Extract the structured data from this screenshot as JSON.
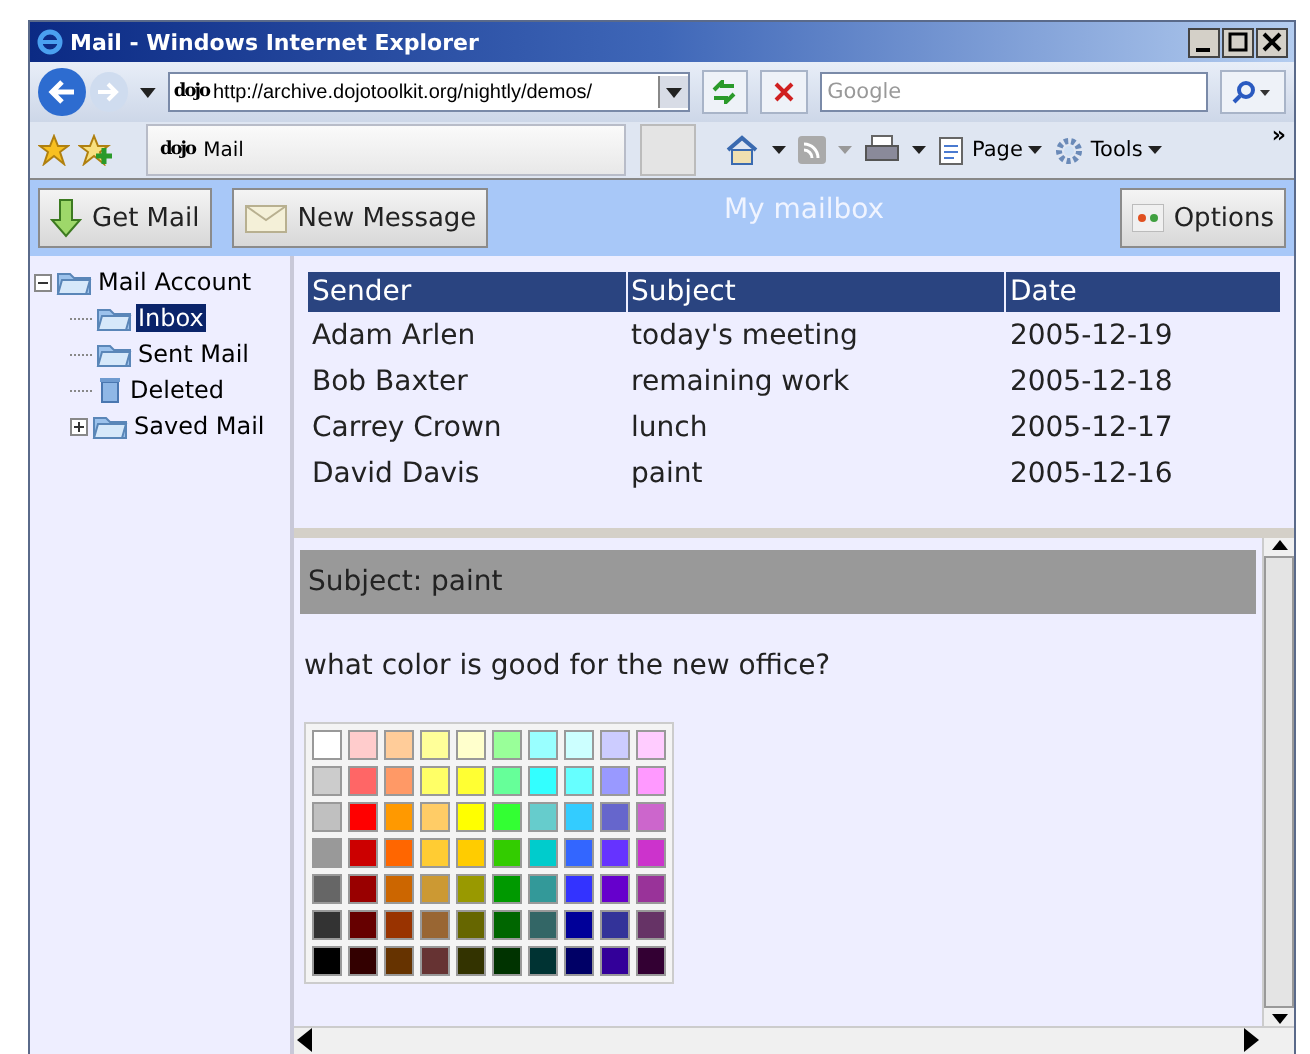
{
  "window": {
    "title": "Mail - Windows Internet Explorer"
  },
  "address_bar": {
    "url": "http://archive.dojotoolkit.org/nightly/demos/",
    "search_placeholder": "Google"
  },
  "tab": {
    "label": "Mail",
    "logo": "dojo"
  },
  "address_logo": "dojo",
  "command_bar": [
    {
      "label": "Page"
    },
    {
      "label": "Tools"
    }
  ],
  "overflow": "»",
  "toolbar": {
    "title": "My mailbox",
    "buttons": [
      {
        "label": "Get Mail",
        "kind": "get"
      },
      {
        "label": "New Message",
        "kind": "new"
      }
    ],
    "options": {
      "label": "Options"
    }
  },
  "tree": [
    {
      "label": "Mail Account",
      "expanded": true,
      "selected": false,
      "children": [
        {
          "label": "Inbox",
          "selected": true,
          "kind": "folder"
        },
        {
          "label": "Sent Mail",
          "selected": false,
          "kind": "folder"
        },
        {
          "label": "Deleted",
          "selected": false,
          "kind": "trash"
        },
        {
          "label": "Saved Mail",
          "selected": false,
          "kind": "folder",
          "expanded": false
        }
      ]
    }
  ],
  "table": {
    "columns": [
      "Sender",
      "Subject",
      "Date"
    ],
    "rows": [
      [
        "Adam Arlen",
        "today's meeting",
        "2005-12-19"
      ],
      [
        "Bob Baxter",
        "remaining work",
        "2005-12-18"
      ],
      [
        "Carrey Crown",
        "lunch",
        "2005-12-17"
      ],
      [
        "David Davis",
        "paint",
        "2005-12-16"
      ]
    ]
  },
  "preview": {
    "subject": "Subject: paint",
    "body": "what color is good for the new office?",
    "palette": [
      [
        {
          "color": "#ffffff"
        },
        {
          "color": "#ffcccc"
        },
        {
          "color": "#ffcc99"
        },
        {
          "color": "#ffff99"
        },
        {
          "color": "#ffffcc"
        },
        {
          "color": "#99ff99"
        },
        {
          "color": "#99ffff"
        },
        {
          "color": "#ccffff"
        },
        {
          "color": "#ccccff"
        },
        {
          "color": "#ffccff"
        }
      ],
      [
        {
          "color": "#cccccc"
        },
        {
          "color": "#ff6666"
        },
        {
          "color": "#ff9966"
        },
        {
          "color": "#ffff66"
        },
        {
          "color": "#ffff33"
        },
        {
          "color": "#66ff99"
        },
        {
          "color": "#33ffff"
        },
        {
          "color": "#66ffff"
        },
        {
          "color": "#9999ff"
        },
        {
          "color": "#ff99ff"
        }
      ],
      [
        {
          "color": "#c0c0c0"
        },
        {
          "color": "#ff0000"
        },
        {
          "color": "#ff9900"
        },
        {
          "color": "#ffcc66"
        },
        {
          "color": "#ffff00"
        },
        {
          "color": "#33ff33"
        },
        {
          "color": "#66cccc"
        },
        {
          "color": "#33ccff"
        },
        {
          "color": "#6666cc"
        },
        {
          "color": "#cc66cc"
        }
      ],
      [
        {
          "color": "#999999"
        },
        {
          "color": "#cc0000"
        },
        {
          "color": "#ff6600"
        },
        {
          "color": "#ffcc33"
        },
        {
          "color": "#ffcc00"
        },
        {
          "color": "#33cc00"
        },
        {
          "color": "#00cccc"
        },
        {
          "color": "#3366ff"
        },
        {
          "color": "#6633ff"
        },
        {
          "color": "#cc33cc"
        }
      ],
      [
        {
          "color": "#666666"
        },
        {
          "color": "#990000"
        },
        {
          "color": "#cc6600"
        },
        {
          "color": "#cc9933"
        },
        {
          "color": "#999900"
        },
        {
          "color": "#009900"
        },
        {
          "color": "#339999"
        },
        {
          "color": "#3333ff"
        },
        {
          "color": "#6600cc"
        },
        {
          "color": "#993399"
        }
      ],
      [
        {
          "color": "#333333"
        },
        {
          "color": "#660000"
        },
        {
          "color": "#993300"
        },
        {
          "color": "#996633"
        },
        {
          "color": "#666600"
        },
        {
          "color": "#006600"
        },
        {
          "color": "#336666"
        },
        {
          "color": "#000099"
        },
        {
          "color": "#333399"
        },
        {
          "color": "#663366"
        }
      ],
      [
        {
          "color": "#000000"
        },
        {
          "color": "#330000"
        },
        {
          "color": "#663300"
        },
        {
          "color": "#663333"
        },
        {
          "color": "#333300"
        },
        {
          "color": "#003300"
        },
        {
          "color": "#003333"
        },
        {
          "color": "#000066"
        },
        {
          "color": "#330099"
        },
        {
          "color": "#330033"
        }
      ]
    ]
  }
}
